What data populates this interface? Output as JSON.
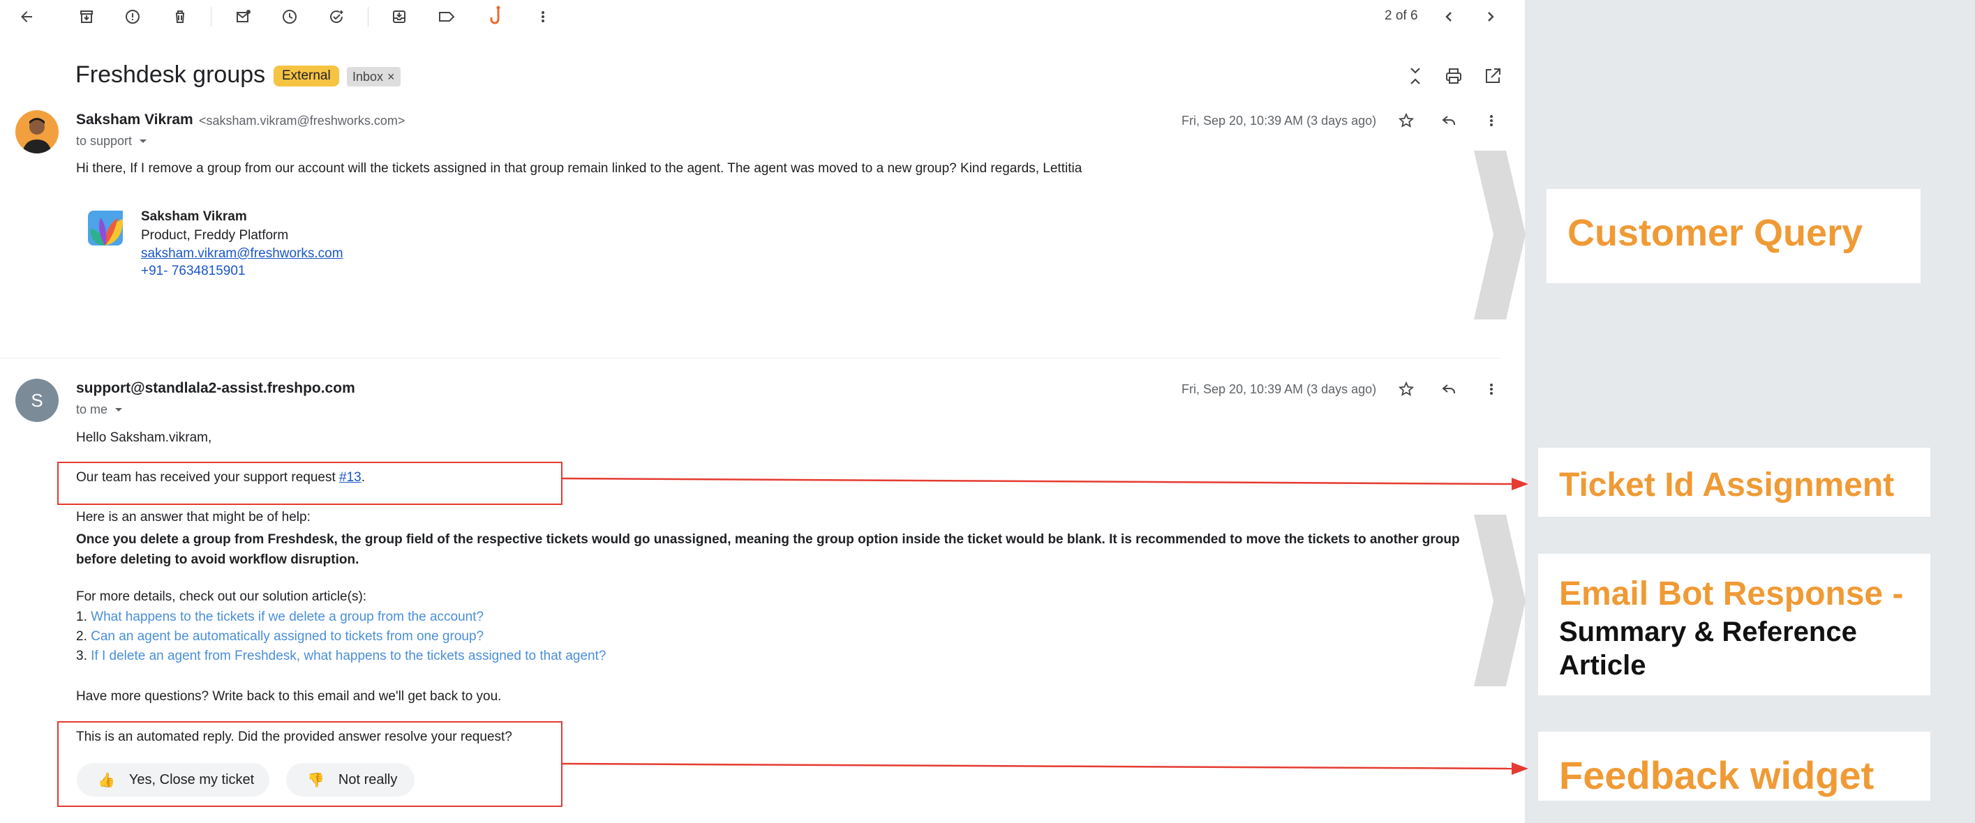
{
  "toolbar": {
    "pager": "2 of 6",
    "icons": [
      "back-arrow-icon",
      "archive-icon",
      "report-spam-icon",
      "delete-icon",
      "mark-unread-icon",
      "snooze-icon",
      "add-task-icon",
      "move-to-icon",
      "label-icon",
      "freshdesk-hook-icon",
      "more-vert-icon",
      "prev-icon",
      "next-icon"
    ]
  },
  "thread": {
    "subject": "Freshdesk groups",
    "badge_external": "External",
    "badge_inbox": "Inbox",
    "badge_inbox_close": "×"
  },
  "message1": {
    "sender_name": "Saksham Vikram",
    "sender_email": "<saksham.vikram@freshworks.com>",
    "to": "to support",
    "date": "Fri, Sep 20, 10:39 AM (3 days ago)",
    "body": "Hi there, If I remove a group from our account will the tickets assigned in that group remain linked to the agent. The agent was moved to a new group? Kind regards, Lettitia",
    "signature": {
      "name": "Saksham Vikram",
      "title": "Product, Freddy Platform",
      "email": "saksham.vikram@freshworks.com",
      "phone": "+91- 7634815901"
    }
  },
  "message2": {
    "avatar_letter": "S",
    "sender": "support@standlala2-assist.freshpo.com",
    "to": "to me",
    "date": "Fri, Sep 20, 10:39 AM (3 days ago)",
    "greeting": "Hello Saksham.vikram,",
    "received_text": "Our team has received your support request ",
    "ticket_link": "#13",
    "received_end": ".",
    "answer_intro": "Here is an answer that might be of help:",
    "answer_bold": "Once you delete a group from Freshdesk, the group field of the respective tickets would go unassigned, meaning the group option inside the ticket would be blank. It is recommended to move the tickets to another group before deleting to avoid workflow disruption.",
    "details_intro": "For more details, check out our solution article(s):",
    "articles": [
      {
        "num": "1.",
        "title": "What happens to the tickets if we delete a group from the account?"
      },
      {
        "num": "2.",
        "title": "Can an agent be automatically assigned to tickets from one group?"
      },
      {
        "num": "3.",
        "title": "If I delete an agent from Freshdesk, what happens to the tickets assigned to that agent?"
      }
    ],
    "more_questions": "Have more questions? Write back to this email and we'll get back to you.",
    "automated": "This is an automated reply. Did the provided answer resolve your request?",
    "yes_label": "Yes, Close my ticket",
    "no_label": "Not really"
  },
  "annotations": {
    "customer_query": "Customer Query",
    "ticket_id": "Ticket Id Assignment",
    "bot_title": "Email Bot Response -",
    "bot_sub1": "Summary & Reference",
    "bot_sub2": "Article",
    "feedback": "Feedback widget"
  },
  "colors": {
    "accent_orange": "#f09a35",
    "badge_yellow": "#f6c343",
    "arrow_red": "#e53b32",
    "link_blue": "#4a8fd8",
    "panel_gray": "#e6e9ec"
  }
}
